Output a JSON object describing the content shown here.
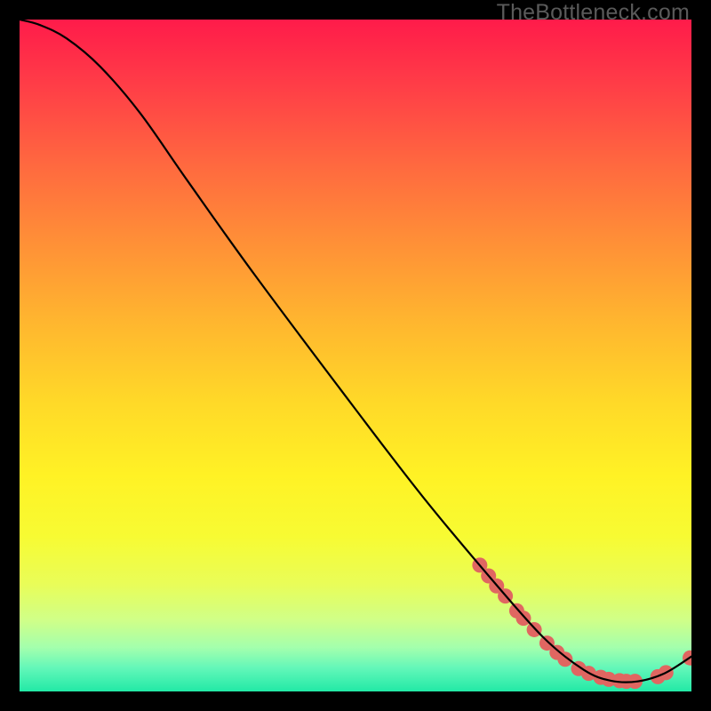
{
  "watermark": "TheBottleneck.com",
  "chart_data": {
    "type": "line",
    "title": "",
    "xlabel": "",
    "ylabel": "",
    "xlim": [
      0,
      100
    ],
    "ylim": [
      0,
      100
    ],
    "curve_points": [
      {
        "x": 0.0,
        "y": 100.0
      },
      {
        "x": 3.0,
        "y": 99.2
      },
      {
        "x": 7.0,
        "y": 97.2
      },
      {
        "x": 12.0,
        "y": 93.0
      },
      {
        "x": 18.0,
        "y": 86.0
      },
      {
        "x": 25.0,
        "y": 76.0
      },
      {
        "x": 35.0,
        "y": 62.0
      },
      {
        "x": 50.0,
        "y": 42.0
      },
      {
        "x": 60.0,
        "y": 29.0
      },
      {
        "x": 70.0,
        "y": 17.0
      },
      {
        "x": 78.0,
        "y": 8.0
      },
      {
        "x": 84.0,
        "y": 3.2
      },
      {
        "x": 88.0,
        "y": 1.6
      },
      {
        "x": 92.0,
        "y": 1.5
      },
      {
        "x": 96.0,
        "y": 2.7
      },
      {
        "x": 100.0,
        "y": 5.2
      }
    ],
    "dot_points": [
      {
        "x": 68.5,
        "y": 18.8
      },
      {
        "x": 69.8,
        "y": 17.2
      },
      {
        "x": 71.0,
        "y": 15.7
      },
      {
        "x": 72.3,
        "y": 14.2
      },
      {
        "x": 74.0,
        "y": 12.0
      },
      {
        "x": 75.0,
        "y": 10.9
      },
      {
        "x": 76.6,
        "y": 9.2
      },
      {
        "x": 78.5,
        "y": 7.2
      },
      {
        "x": 80.0,
        "y": 5.8
      },
      {
        "x": 81.2,
        "y": 4.8
      },
      {
        "x": 83.2,
        "y": 3.4
      },
      {
        "x": 84.7,
        "y": 2.7
      },
      {
        "x": 86.5,
        "y": 2.1
      },
      {
        "x": 87.7,
        "y": 1.8
      },
      {
        "x": 89.3,
        "y": 1.6
      },
      {
        "x": 90.3,
        "y": 1.5
      },
      {
        "x": 91.6,
        "y": 1.5
      },
      {
        "x": 95.0,
        "y": 2.2
      },
      {
        "x": 96.2,
        "y": 2.8
      },
      {
        "x": 99.8,
        "y": 5.0
      }
    ],
    "dot_color": "#e06661",
    "dot_radius": 8.5,
    "curve_color": "#000000",
    "curve_width": 2.2
  }
}
